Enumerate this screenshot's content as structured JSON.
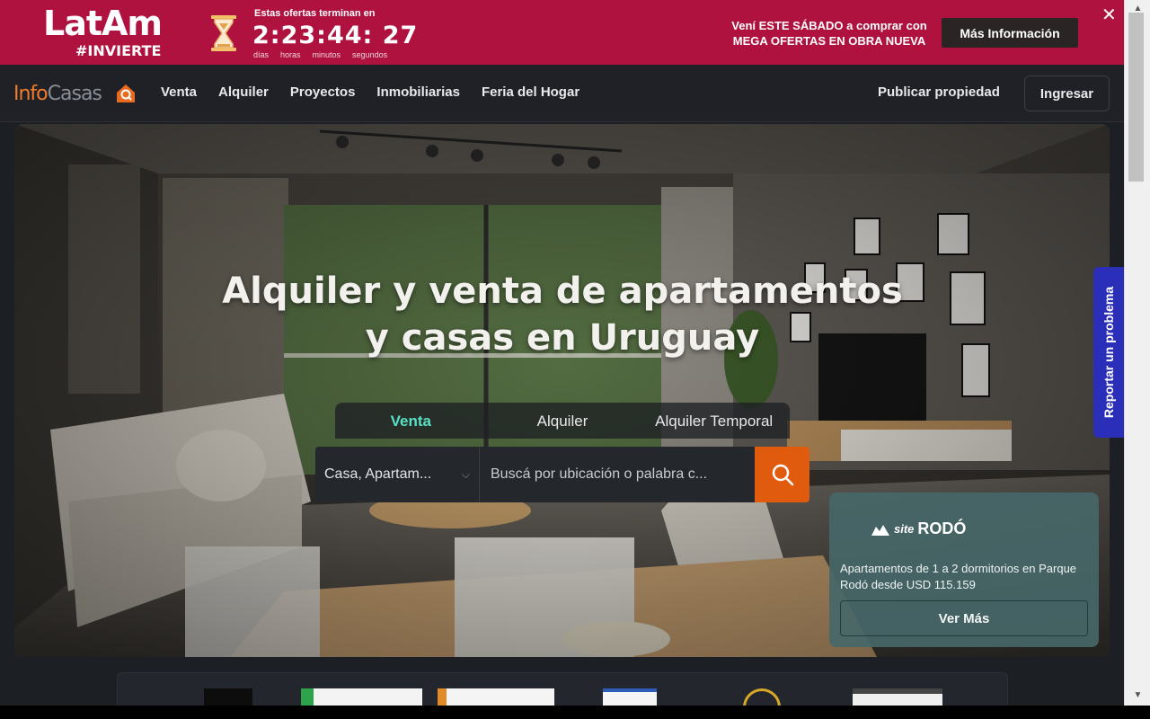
{
  "promo": {
    "logo_main": "LatAm",
    "logo_tag": "#INVIERTE",
    "offer_label": "Estas ofertas terminan en",
    "countdown": "2:23:44: 27",
    "units": [
      "días",
      "horas",
      "minutos",
      "segundos"
    ],
    "cta_text": "Vení ESTE SÁBADO a comprar con MEGA OFERTAS EN OBRA NUEVA",
    "cta_button": "Más Información",
    "close": "✕"
  },
  "nav": {
    "brand_part1": "Info",
    "brand_part2": "Casas",
    "links": [
      "Venta",
      "Alquiler",
      "Proyectos",
      "Inmobiliarias",
      "Feria del Hogar"
    ],
    "publish": "Publicar propiedad",
    "login": "Ingresar"
  },
  "hero": {
    "title": "Alquiler y venta de apartamentos y casas en Uruguay",
    "tabs": [
      "Venta",
      "Alquiler",
      "Alquiler Temporal"
    ],
    "active_tab": "Venta",
    "property_type": "Casa, Apartam...",
    "search_placeholder": "Buscá por ubicación o palabra c..."
  },
  "promo_card": {
    "logo_prefix": "site",
    "logo_name": "RODÓ",
    "description": "Apartamentos de 1 a 2 dormitorios en Parque Rodó desde USD 115.159",
    "button": "Ver Más"
  },
  "report": "Reportar un problema",
  "colors": {
    "promo_bar": "#b0123f",
    "accent_orange": "#e15b0f",
    "active_tab": "#58e0c6",
    "report_tab": "#2b2eb8"
  }
}
